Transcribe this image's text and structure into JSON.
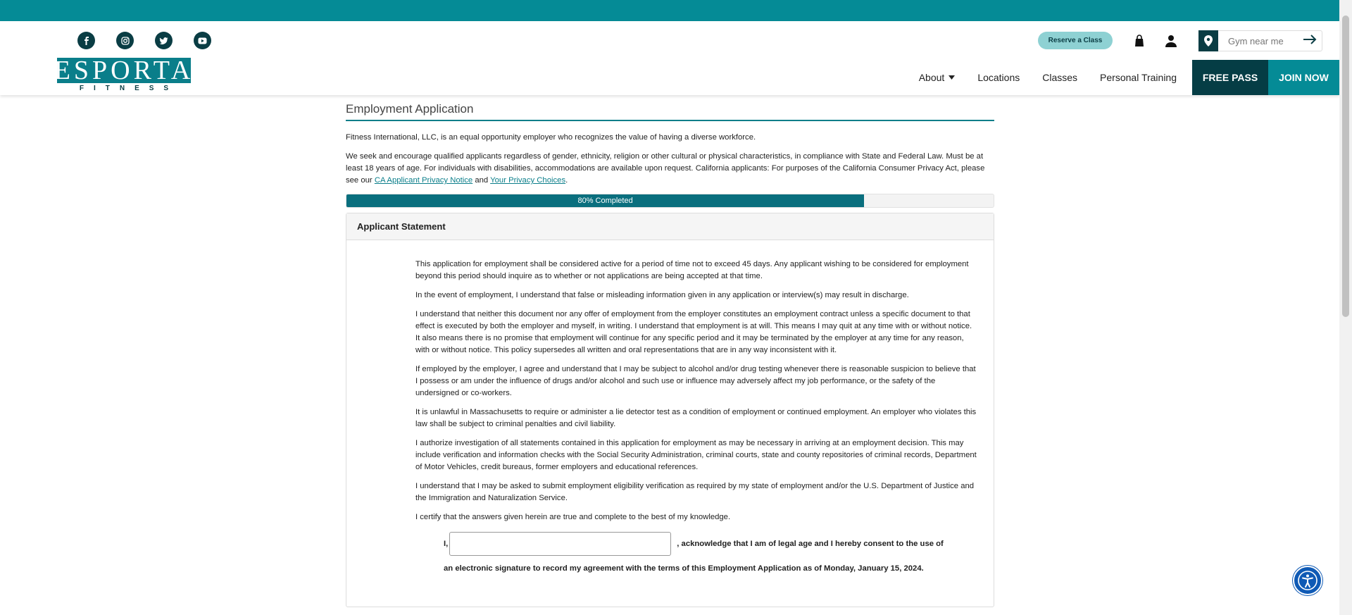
{
  "header": {
    "social": [
      "facebook-icon",
      "instagram-icon",
      "twitter-icon",
      "youtube-icon"
    ],
    "logo": {
      "name": "ESPORTA",
      "sub": "FITNESS"
    },
    "reserve_label": "Reserve a Class",
    "gym_placeholder": "Gym near me",
    "nav": {
      "about": "About",
      "locations": "Locations",
      "classes": "Classes",
      "personal_training": "Personal Training",
      "free_pass": "FREE PASS",
      "join_now": "JOIN NOW"
    }
  },
  "main": {
    "title": "Employment Application",
    "intro1": "Fitness International, LLC, is an equal opportunity employer who recognizes the value of having a diverse workforce.",
    "intro2_text": "We seek and encourage qualified applicants regardless of gender, ethnicity, religion or other cultural or physical characteristics, in compliance with State and Federal Law. Must be at least 18 years of age. For individuals with disabilities, accommodations are available upon request. California applicants: For purposes of the California Consumer Privacy Act, please see our ",
    "intro2_link1": "CA Applicant Privacy Notice",
    "intro2_and": " and ",
    "intro2_link2": "Your Privacy Choices",
    "intro2_end": ".",
    "progress_label": "80% Completed",
    "progress_value": 0.8,
    "panel_title": "Applicant Statement",
    "paragraphs": [
      "This application for employment shall be considered active for a period of time not to exceed 45 days. Any applicant wishing to be considered for employment beyond this period should inquire as to whether or not applications are being accepted at that time.",
      "In the event of employment, I understand that false or misleading information given in any application or interview(s) may result in discharge.",
      "I understand that neither this document nor any offer of employment from the employer constitutes an employment contract unless a specific document to that effect is executed by both the employer and myself, in writing. I understand that employment is at will. This means I may quit at any time with or without notice. It also means there is no promise that employment will continue for any specific period and it may be terminated by the employer at any time for any reason, with or without notice. This policy supersedes all written and oral representations that are in any way inconsistent with it.",
      "If employed by the employer, I agree and understand that I may be subject to alcohol and/or drug testing whenever there is reasonable suspicion to believe that I possess or am under the influence of drugs and/or alcohol and such use or influence may adversely affect my job performance, or the safety of the undersigned or co-workers.",
      "It is unlawful in Massachusetts to require or administer a lie detector test as a condition of employment or continued employment. An employer who violates this law shall be subject to criminal penalties and civil liability.",
      "I authorize investigation of all statements contained in this application for employment as may be necessary in arriving at an employment decision. This may include verification and information checks with the Social Security Administration, criminal courts, state and county repositories of criminal records, Department of Motor Vehicles, credit bureaus, former employers and educational references.",
      "I understand that I may be asked to submit employment eligibility verification as required by my state of employment and/or the U.S. Department of Justice and the Immigration and Naturalization Service.",
      "I certify that the answers given herein are true and complete to the best of my knowledge."
    ],
    "sig_prefix": "I,",
    "sig_text1": ", acknowledge that I am of legal age and I hereby consent to the use of",
    "sig_text2": "an electronic signature to record my agreement with the terms of this Employment Application as of  Monday, January 15, 2024."
  },
  "colors": {
    "teal": "#058b96",
    "dark_teal": "#053d45"
  }
}
